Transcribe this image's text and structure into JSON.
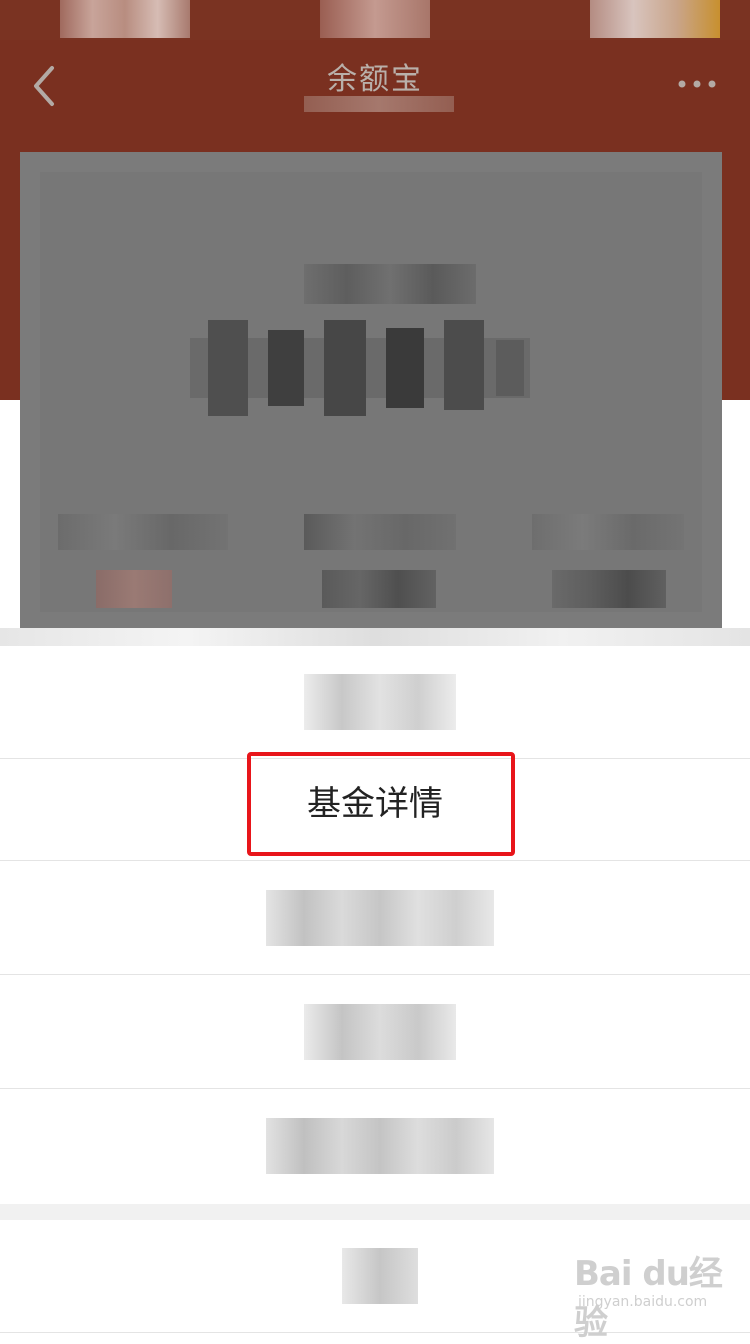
{
  "colors": {
    "nav_background": "#7a3020",
    "dim_card": "#777777",
    "highlight_border": "#e8151a",
    "sheet_background": "#ffffff",
    "divider": "#e4e4e4"
  },
  "nav": {
    "title": "余额宝",
    "back_icon": "chevron-left-icon",
    "more_icon": "ellipsis-icon"
  },
  "action_sheet": {
    "items": [
      {
        "label": "",
        "obscured": true
      },
      {
        "label": "基金详情",
        "obscured": false,
        "highlighted": true
      },
      {
        "label": "",
        "obscured": true
      },
      {
        "label": "",
        "obscured": true
      },
      {
        "label": "",
        "obscured": true
      }
    ],
    "cancel": {
      "label": "",
      "obscured": true
    }
  },
  "watermark": {
    "logo": "Bai du经验",
    "url": "jingyan.baidu.com"
  }
}
